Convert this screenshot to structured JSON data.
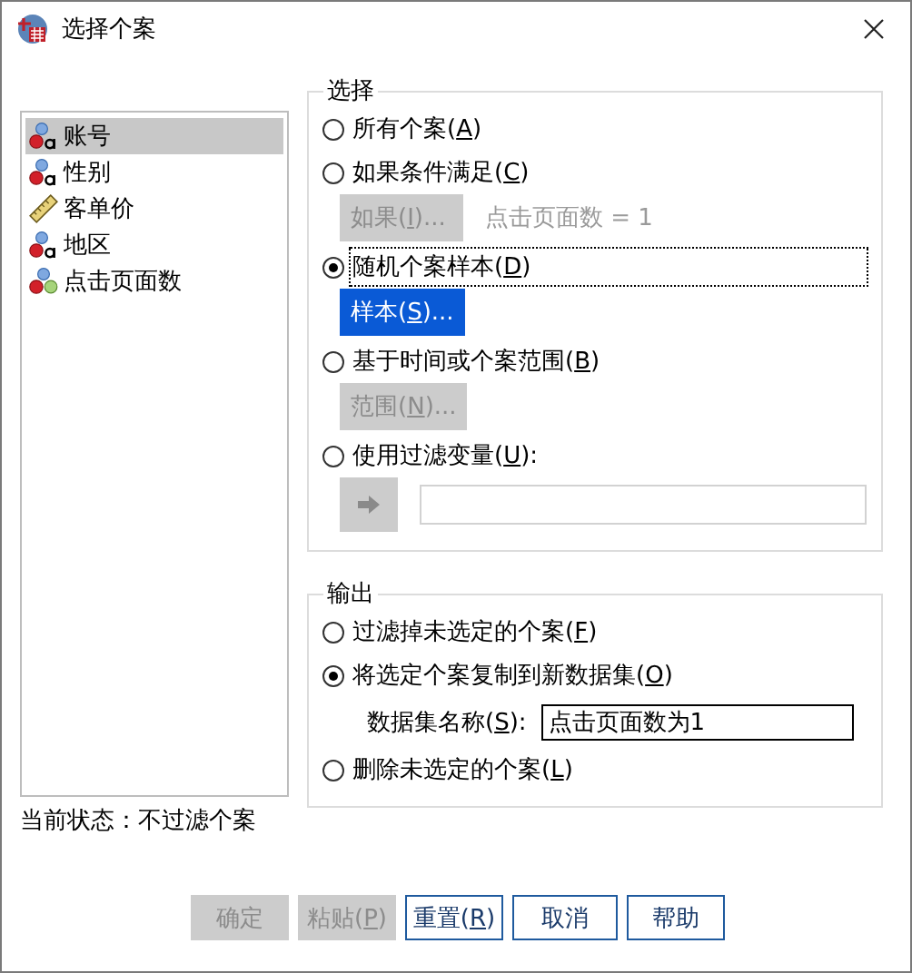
{
  "window": {
    "title": "选择个案"
  },
  "variables": [
    {
      "label": "账号",
      "kind": "string",
      "selected": true
    },
    {
      "label": "性别",
      "kind": "string",
      "selected": false
    },
    {
      "label": "客单价",
      "kind": "scale",
      "selected": false
    },
    {
      "label": "地区",
      "kind": "string",
      "selected": false
    },
    {
      "label": "点击页面数",
      "kind": "nominal",
      "selected": false
    }
  ],
  "select": {
    "title": "选择",
    "options": [
      {
        "label": "所有个案(A)",
        "selected": false,
        "focused": false
      },
      {
        "label": "如果条件满足(C)",
        "selected": false,
        "focused": false,
        "button": {
          "label": "如果(I)...",
          "disabled": true
        },
        "note": "点击页面数 = 1"
      },
      {
        "label": "随机个案样本(D)",
        "selected": true,
        "focused": true,
        "button": {
          "label": "样本(S)...",
          "disabled": false
        }
      },
      {
        "label": "基于时间或个案范围(B)",
        "selected": false,
        "focused": false,
        "button": {
          "label": "范围(N)...",
          "disabled": true
        }
      },
      {
        "label": "使用过滤变量(U):",
        "selected": false,
        "focused": false,
        "filter": {
          "disabled": true
        }
      }
    ]
  },
  "output": {
    "title": "输出",
    "options": [
      {
        "label": "过滤掉未选定的个案(F)",
        "selected": false
      },
      {
        "label": "将选定个案复制到新数据集(O)",
        "selected": true,
        "field": {
          "label": "数据集名称(S):",
          "value": "点击页面数为1"
        }
      },
      {
        "label": "删除未选定的个案(L)",
        "selected": false
      }
    ]
  },
  "status": "当前状态：不过滤个案",
  "buttons": [
    {
      "label": "确定",
      "disabled": true
    },
    {
      "label": "粘贴(P)",
      "disabled": true
    },
    {
      "label": "重置(R)",
      "disabled": false
    },
    {
      "label": "取消",
      "disabled": false
    },
    {
      "label": "帮助",
      "disabled": false
    }
  ]
}
